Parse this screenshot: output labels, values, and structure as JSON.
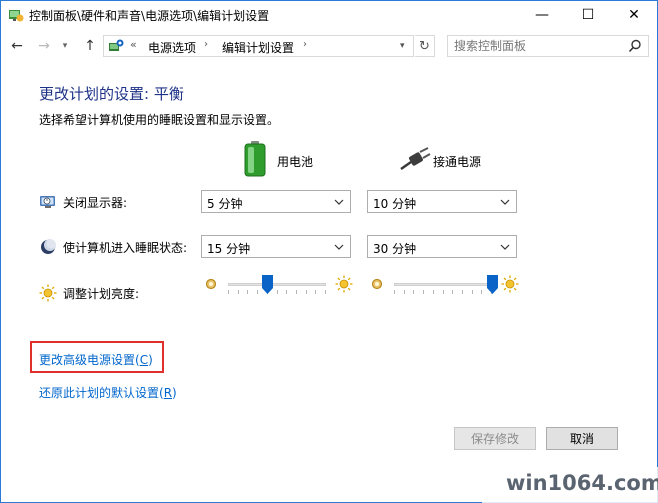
{
  "window": {
    "title": "控制面板\\硬件和声音\\电源选项\\编辑计划设置",
    "minimize_glyph": "—",
    "maximize_glyph": "☐",
    "close_glyph": "✕"
  },
  "nav": {
    "back_glyph": "←",
    "forward_glyph": "→",
    "dropdown_glyph": "▾",
    "up_glyph": "↑",
    "chevron": "«",
    "breadcrumbs": [
      "电源选项",
      "编辑计划设置"
    ],
    "separator": "›",
    "address_dropdown": "▾",
    "refresh_glyph": "↻",
    "search_placeholder": "搜索控制面板"
  },
  "page": {
    "title": "更改计划的设置: 平衡",
    "subtitle": "选择希望计算机使用的睡眠设置和显示设置。"
  },
  "columns": {
    "battery": "用电池",
    "plugged_in": "接通电源"
  },
  "settings": [
    {
      "label": "关闭显示器:",
      "battery": "5 分钟",
      "plugged_in": "10 分钟"
    },
    {
      "label": "使计算机进入睡眠状态:",
      "battery": "15 分钟",
      "plugged_in": "30 分钟"
    }
  ],
  "brightness": {
    "label": "调整计划亮度:",
    "battery_level": 0.4,
    "plugged_in_level": 1.0
  },
  "links": {
    "advanced": "更改高级电源设置(C)",
    "advanced_prefix": "更改高级电源设置(",
    "advanced_key": "C",
    "advanced_suffix": ")",
    "restore_prefix": "还原此计划的默认设置(",
    "restore_key": "R",
    "restore_suffix": ")"
  },
  "buttons": {
    "save": "保存修改",
    "cancel": "取消"
  },
  "watermark": "win1064.com",
  "colors": {
    "title_blue": "#1e3287",
    "link_blue": "#0066cc",
    "highlight_red": "#e0302b",
    "slider_thumb": "#0a64c8"
  }
}
